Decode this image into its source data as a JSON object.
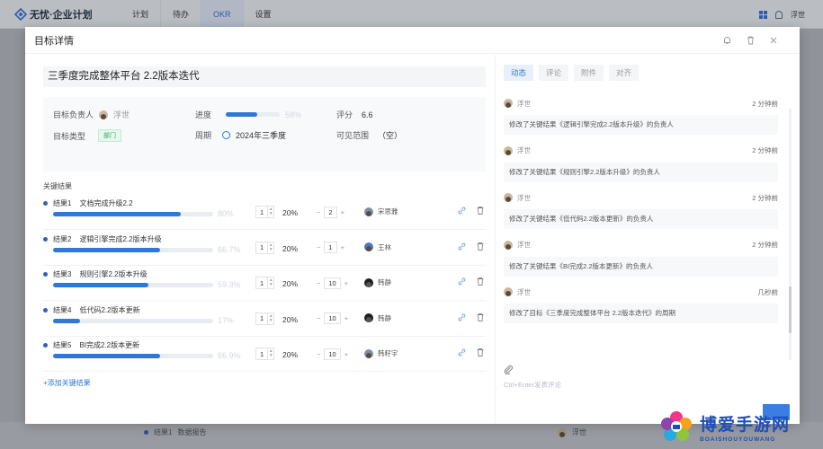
{
  "app": {
    "name": "无忧·企业计划",
    "nav": [
      {
        "label": "计划",
        "active": false
      },
      {
        "label": "待办",
        "active": false
      },
      {
        "label": "OKR",
        "active": true
      },
      {
        "label": "设置",
        "active": false
      }
    ],
    "user": "浮世"
  },
  "modal": {
    "title": "目标详情",
    "objective_title": "三季度完成整体平台 2.2版本迭代",
    "info": {
      "owner_label": "目标负责人",
      "owner": "浮世",
      "progress_label": "进度",
      "progress_value": 0.58,
      "progress_text": "58%",
      "score_label": "评分",
      "score": "6.6",
      "type_label": "目标类型",
      "type_tag": "部门",
      "period_label": "周期",
      "period": "2024年三季度",
      "visibility_label": "可见范围",
      "visibility": "（空）"
    },
    "kr_header": "关键结果",
    "key_results": [
      {
        "label": "结果1",
        "name": "文档完成升级2.2",
        "progress": 0.8,
        "progress_text": "80%",
        "confidence": "1",
        "weight": "20%",
        "score": "2",
        "owner": "宋思雅",
        "avatar": "img"
      },
      {
        "label": "结果2",
        "name": "逻辑引擎完成2.2版本升级",
        "progress": 0.667,
        "progress_text": "66.7%",
        "confidence": "1",
        "weight": "20%",
        "score": "1",
        "owner": "王林",
        "avatar": "blue"
      },
      {
        "label": "结果3",
        "name": "规则引擎2.2版本升级",
        "progress": 0.593,
        "progress_text": "59.3%",
        "confidence": "1",
        "weight": "20%",
        "score": "10",
        "owner": "韩静",
        "avatar": "dark"
      },
      {
        "label": "结果4",
        "name": "低代码2.2版本更新",
        "progress": 0.17,
        "progress_text": "17%",
        "confidence": "1",
        "weight": "20%",
        "score": "10",
        "owner": "韩静",
        "avatar": "dark"
      },
      {
        "label": "结果5",
        "name": "BI完成2.2版本更新",
        "progress": 0.669,
        "progress_text": "66.9%",
        "confidence": "1",
        "weight": "20%",
        "score": "10",
        "owner": "韩籽宇",
        "avatar": "img"
      }
    ],
    "add_kr": "+添加关键结果",
    "tabs": [
      {
        "label": "动态",
        "active": true
      },
      {
        "label": "评论",
        "active": false
      },
      {
        "label": "附件",
        "active": false
      },
      {
        "label": "对齐",
        "active": false
      }
    ],
    "activities": [
      {
        "who": "浮世",
        "time": "2 分钟前",
        "text": "修改了关键结果《逻辑引擎完成2.2版本升级》的负责人"
      },
      {
        "who": "浮世",
        "time": "2 分钟前",
        "text": "修改了关键结果《规则引擎2.2版本升级》的负责人"
      },
      {
        "who": "浮世",
        "time": "2 分钟前",
        "text": "修改了关键结果《低代码2.2版本更新》的负责人"
      },
      {
        "who": "浮世",
        "time": "2 分钟前",
        "text": "修改了关键结果《BI完成2.2版本更新》的负责人"
      },
      {
        "who": "浮世",
        "time": "几秒前",
        "text": "修改了目标《三季度完成整体平台 2.2版本迭代》的周期"
      }
    ],
    "comment_placeholder": "Ctrl+Enter发表评论"
  },
  "background": {
    "row_label": "结果1",
    "row_name": "数据报告",
    "row_owner": "浮世"
  },
  "watermark": {
    "title": "博爱手游网",
    "subtitle": "BOAISHOUYOUWANG"
  },
  "colors": {
    "accent": "#2f78d9",
    "nav_active": "#2f6fe0",
    "tag_green": "#3aa76d"
  }
}
